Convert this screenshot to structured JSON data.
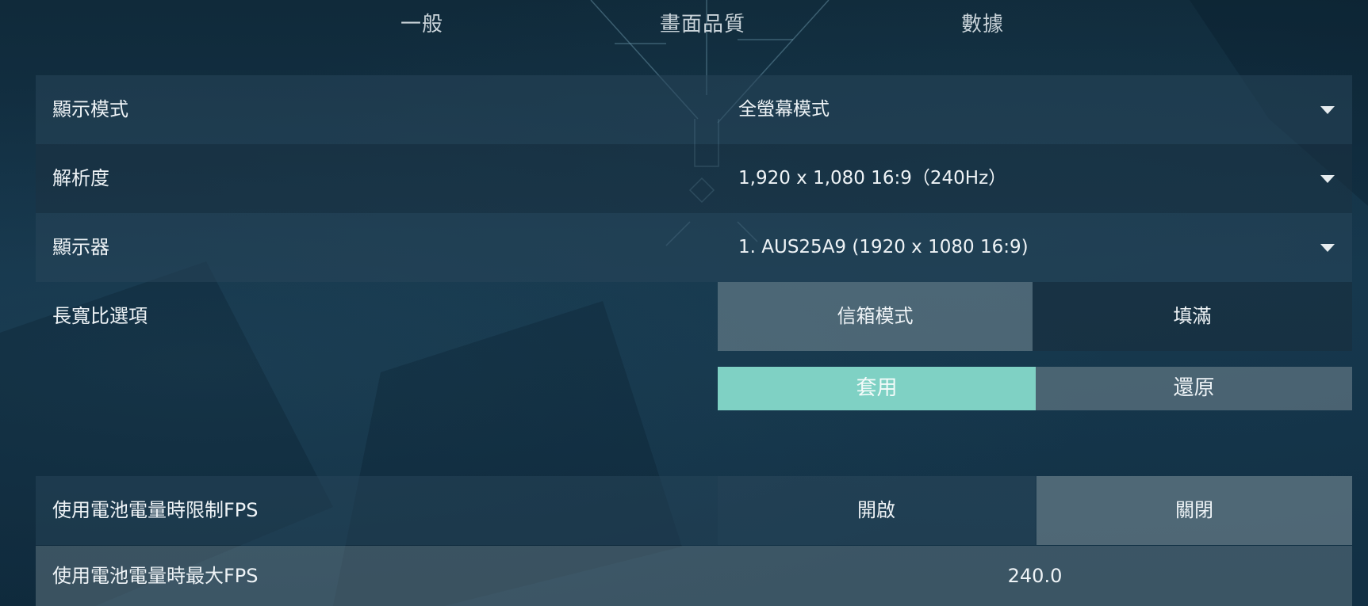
{
  "tabs": {
    "general": "一般",
    "video": "畫面品質",
    "stats": "數據"
  },
  "settings": {
    "display_mode": {
      "label": "顯示模式",
      "value": "全螢幕模式"
    },
    "resolution": {
      "label": "解析度",
      "value": "1,920 x 1,080 16:9（240Hz）"
    },
    "monitor": {
      "label": "顯示器",
      "value": "1. AUS25A9 (1920 x  1080 16:9)"
    },
    "aspect_ratio": {
      "label": "長寬比選項",
      "options": [
        "信箱模式",
        "填滿"
      ],
      "selected": "信箱模式"
    },
    "limit_fps_on_battery": {
      "label": "使用電池電量時限制FPS",
      "options": [
        "開啟",
        "關閉"
      ],
      "selected": "關閉"
    },
    "max_fps_on_battery": {
      "label": "使用電池電量時最大FPS",
      "value": "240.0"
    }
  },
  "actions": {
    "apply": "套用",
    "revert": "還原"
  },
  "colors": {
    "apply_accent": "#7fd1c4",
    "background": "#14344a"
  }
}
